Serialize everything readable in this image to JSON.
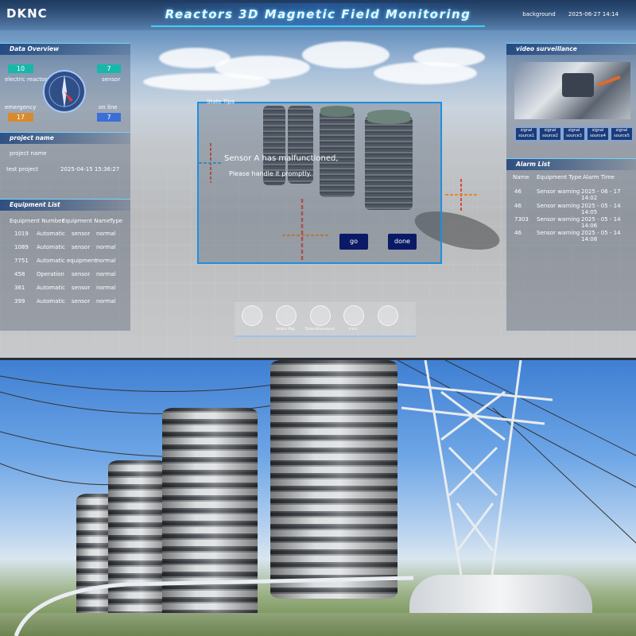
{
  "header": {
    "logo": "DKNC",
    "title": "Reactors 3D Magnetic Field Monitoring",
    "background_label": "background",
    "datetime": "2025-06-27 14:14"
  },
  "data_overview": {
    "title": "Data Overview",
    "electric_reactor": {
      "label": "electric reactor",
      "value": "10"
    },
    "sensor": {
      "label": "sensor",
      "value": "7"
    },
    "emergency": {
      "label": "emergency",
      "value": "17"
    },
    "on_line": {
      "label": "on line",
      "value": "7"
    },
    "colors": {
      "teal": "#18b8a8",
      "orange": "#d98a2e",
      "blue": "#3b6fd6"
    }
  },
  "project": {
    "title": "project name",
    "header": "project name",
    "name": "test project",
    "date": "2025-04-15 15:36:27"
  },
  "equipment": {
    "title": "Equipment List",
    "columns": [
      "Equipment Number",
      "Equipment Name",
      "Type"
    ],
    "rows": [
      [
        "1019",
        "Automatic",
        "sensor",
        "normal"
      ],
      [
        "1089",
        "Automatic",
        "sensor",
        "normal"
      ],
      [
        "7751",
        "Automatic",
        "equipment",
        "normal"
      ],
      [
        "458",
        "Operation",
        "sensor",
        "normal"
      ],
      [
        "361",
        "Automatic",
        "sensor",
        "normal"
      ],
      [
        "399",
        "Automatic",
        "sensor",
        "normal"
      ]
    ]
  },
  "video": {
    "title": "video surveillance",
    "sources": [
      "signal source1",
      "signal source2",
      "signal source3",
      "signal source4",
      "signal source5"
    ]
  },
  "alarm": {
    "title": "Alarm List",
    "columns": [
      "Name",
      "Equipment Type",
      "Alarm Time"
    ],
    "rows": [
      [
        "46",
        "Sensor warning",
        "2025 - 06 - 17 14:02"
      ],
      [
        "46",
        "Sensor warning",
        "2025 - 05 - 14 14:05"
      ],
      [
        "7303",
        "Sensor warning",
        "2025 - 05 - 14 14:06"
      ],
      [
        "46",
        "Sensor warning",
        "2025 - 05 - 14 14:08"
      ]
    ]
  },
  "dialog": {
    "title": "State Tips",
    "message": "Sensor A has malfunctioned,",
    "instruction": "Please handle it promptly.",
    "go": "go",
    "done": "done"
  },
  "toolbar": {
    "items": [
      "",
      "Hidden Map",
      "Three-dimensional",
      "more",
      ""
    ]
  }
}
